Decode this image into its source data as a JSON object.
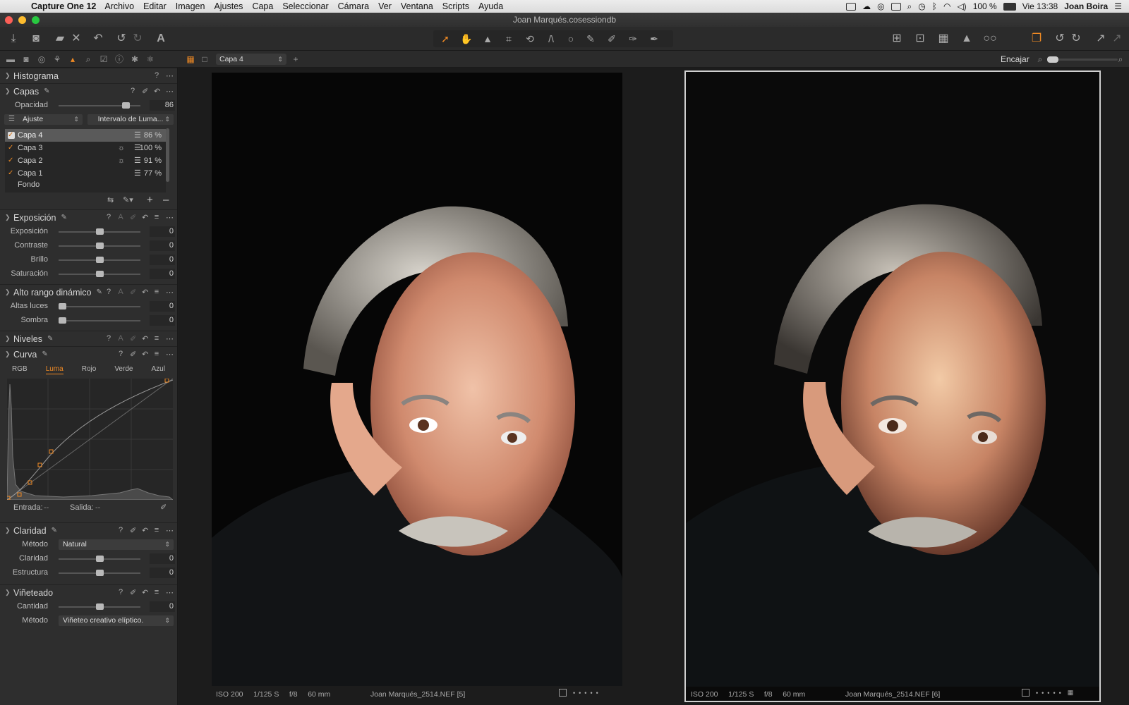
{
  "menubar": {
    "app_name": "Capture One 12",
    "menus": [
      "Archivo",
      "Editar",
      "Imagen",
      "Ajustes",
      "Capa",
      "Seleccionar",
      "Cámara",
      "Ver",
      "Ventana",
      "Scripts",
      "Ayuda"
    ],
    "battery": "100 %",
    "clock": "Vie 13:38",
    "user": "Joan Boira"
  },
  "window": {
    "title": "Joan Marqués.cosessiondb"
  },
  "subbar": {
    "variant_selector": "Capa 4",
    "fit_label": "Encajar"
  },
  "panel": {
    "histogram": {
      "title": "Histograma"
    },
    "layers": {
      "title": "Capas",
      "opacity_label": "Opacidad",
      "opacity_value": "86",
      "adjust_select": "Ajuste",
      "luma_range_button": "Intervalo de Luma...",
      "items": [
        {
          "name": "Capa 4",
          "pct": "86 %",
          "sun": false
        },
        {
          "name": "Capa 3",
          "pct": "100 %",
          "sun": true
        },
        {
          "name": "Capa 2",
          "pct": "91 %",
          "sun": true
        },
        {
          "name": "Capa 1",
          "pct": "77 %",
          "sun": false
        },
        {
          "name": "Fondo",
          "pct": "",
          "sun": false
        }
      ]
    },
    "exposure": {
      "title": "Exposición",
      "rows": [
        {
          "label": "Exposición",
          "value": "0"
        },
        {
          "label": "Contraste",
          "value": "0"
        },
        {
          "label": "Brillo",
          "value": "0"
        },
        {
          "label": "Saturación",
          "value": "0"
        }
      ]
    },
    "hdr": {
      "title": "Alto rango dinámico",
      "rows": [
        {
          "label": "Altas luces",
          "value": "0"
        },
        {
          "label": "Sombra",
          "value": "0"
        }
      ]
    },
    "levels": {
      "title": "Niveles"
    },
    "curve": {
      "title": "Curva",
      "tabs": [
        "RGB",
        "Luma",
        "Rojo",
        "Verde",
        "Azul"
      ],
      "active_tab": "Luma",
      "input_label": "Entrada:",
      "input_value": "--",
      "output_label": "Salida:",
      "output_value": "--"
    },
    "clarity": {
      "title": "Claridad",
      "method_label": "Método",
      "method_value": "Natural",
      "rows": [
        {
          "label": "Claridad",
          "value": "0"
        },
        {
          "label": "Estructura",
          "value": "0"
        }
      ]
    },
    "vignette": {
      "title": "Viñeteado",
      "amount_label": "Cantidad",
      "amount_value": "0",
      "method_label": "Método",
      "method_value": "Viñeteo creativo elíptico."
    }
  },
  "viewer": {
    "left": {
      "iso": "ISO 200",
      "shutter": "1/125 S",
      "aperture": "f/8",
      "focal": "60 mm",
      "file": "Joan Marqués_2514.NEF [5]"
    },
    "right": {
      "iso": "ISO 200",
      "shutter": "1/125 S",
      "aperture": "f/8",
      "focal": "60 mm",
      "file": "Joan Marqués_2514.NEF [6]"
    }
  },
  "colors": {
    "accent": "#f08a24",
    "panel_bg": "#2e2e2e",
    "viewer_bg": "#1c1c1c"
  }
}
